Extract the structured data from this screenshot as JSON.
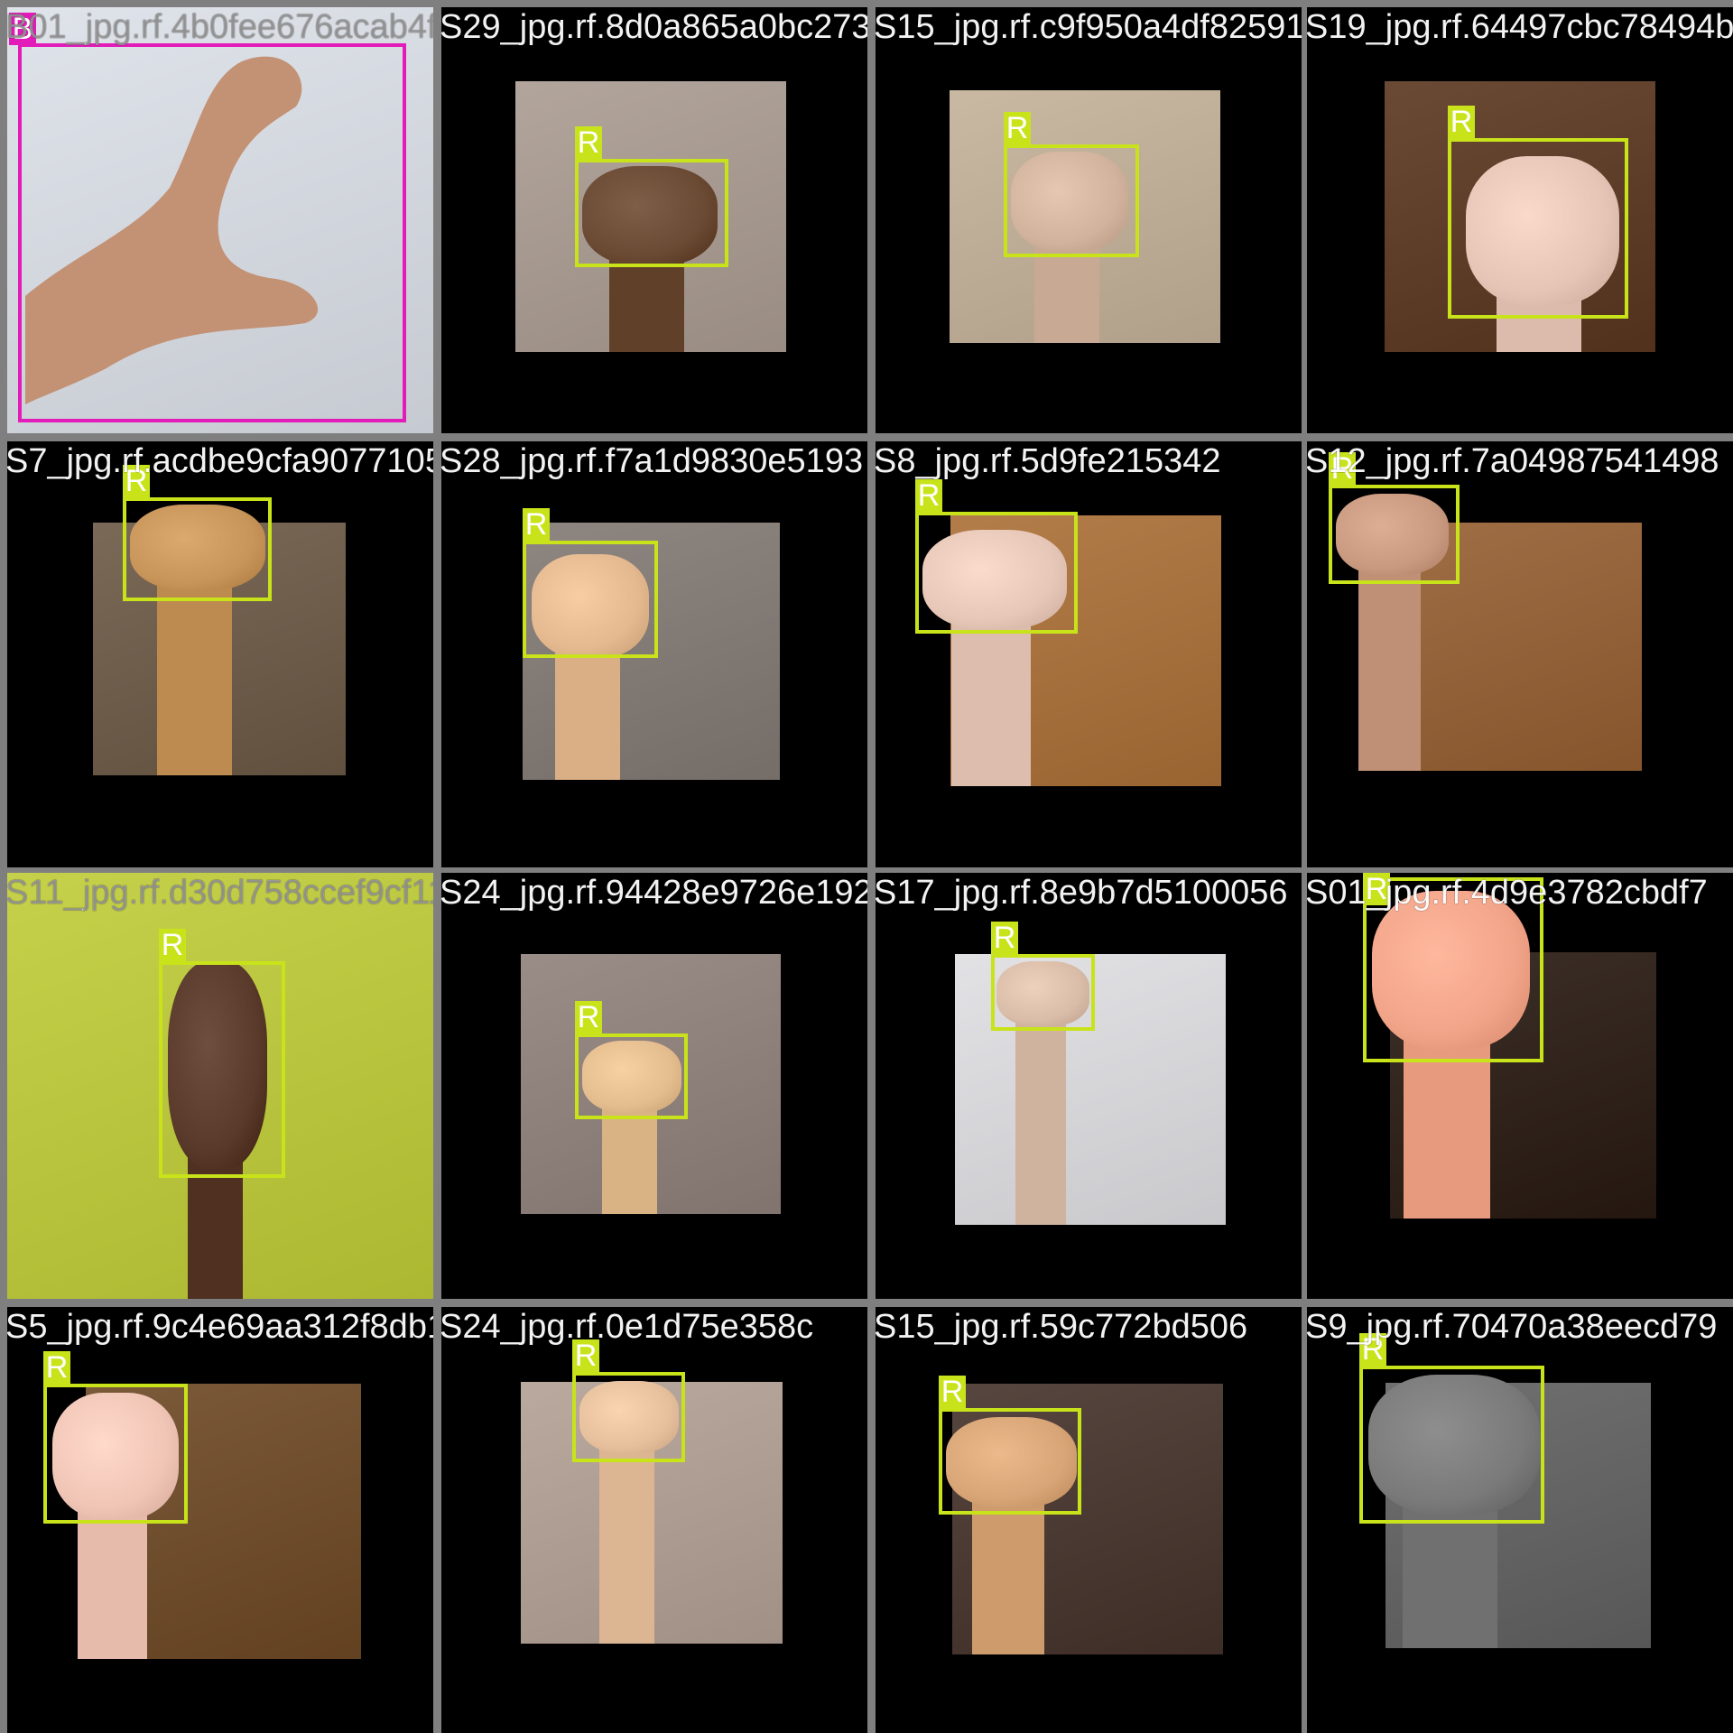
{
  "grid": {
    "columns": 4,
    "rows": 4
  },
  "tiles": [
    {
      "label": "B",
      "file": "B01_jpg.rf.4b0fee676acab4f",
      "bg": "#dfe3ea",
      "skin": "#c39174",
      "pink": true
    },
    {
      "label": "R",
      "file": "S29_jpg.rf.8d0a865a0bc27390",
      "bg": "#b2a59c",
      "skin": "#6b4a34"
    },
    {
      "label": "R",
      "file": "S15_jpg.rf.c9f950a4df8259176",
      "bg": "#c9b9a3",
      "skin": "#d2b39d"
    },
    {
      "label": "R",
      "file": "S19_jpg.rf.64497cbc78494b",
      "bg": "#6a4a35",
      "skin": "#e6c4b6"
    },
    {
      "label": "R",
      "file": "S7_jpg.rf.acdbe9cfa90771056",
      "bg": "#7b6958",
      "skin": "#c79559"
    },
    {
      "label": "R",
      "file": "S28_jpg.rf.f7a1d9830e5193",
      "bg": "#8e8681",
      "skin": "#e4b98f"
    },
    {
      "label": "R",
      "file": "S8_jpg.rf.5d9fe215342",
      "bg": "#b37d4a",
      "skin": "#e7c7b7"
    },
    {
      "label": "R",
      "file": "S12_jpg.rf.7a04987541498",
      "bg": "#a06e45",
      "skin": "#c99a80"
    },
    {
      "label": "R",
      "file": "S11_jpg.rf.d30d758ccef9cf11",
      "bg": "#c5d14a",
      "skin": "#5a3a2a"
    },
    {
      "label": "R",
      "file": "S24_jpg.rf.94428e9726e192",
      "bg": "#9a8c86",
      "skin": "#e4bd8f"
    },
    {
      "label": "R",
      "file": "S17_jpg.rf.8e9b7d5100056",
      "bg": "#e2e2e5",
      "skin": "#d9bda9"
    },
    {
      "label": "R",
      "file": "S01_jpg.rf.4d9e3782cbdf7",
      "bg": "#3d3028",
      "skin": "#f2a489"
    },
    {
      "label": "R",
      "file": "S5_jpg.rf.9c4e69aa312f8db1",
      "bg": "#7b5a3a",
      "skin": "#f0c5b6"
    },
    {
      "label": "R",
      "file": "S24_jpg.rf.0e1d75e358c",
      "bg": "#b9a99f",
      "skin": "#e6c09d"
    },
    {
      "label": "R",
      "file": "S15_jpg.rf.59c772bd506",
      "bg": "#57463f",
      "skin": "#d8a577"
    },
    {
      "label": "R",
      "file": "S9_jpg.rf.70470a38eecd79",
      "bg": "#707070",
      "skin": "#7a7a7a"
    }
  ]
}
